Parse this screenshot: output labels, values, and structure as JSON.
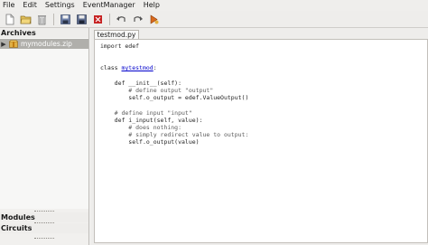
{
  "menu": [
    "File",
    "Edit",
    "Settings",
    "EventManager",
    "Help"
  ],
  "toolbar": {
    "buttons": [
      "new-file",
      "open-file",
      "delete",
      "save",
      "save-as",
      "close",
      "undo",
      "redo",
      "run"
    ]
  },
  "sidebar": {
    "archives_label": "Archives",
    "archive_item": "mymodules.zip",
    "modules_label": "Modules",
    "circuits_label": "Circuits"
  },
  "editor": {
    "tab_label": "testmod.py",
    "lines": [
      {
        "pre": "import edef",
        "cls": "",
        "post": "",
        "type": "code"
      },
      {
        "pre": "class ",
        "cls": "mytestmod",
        "post": ":",
        "type": "code"
      },
      {
        "pre": "    def __init__(self):",
        "cls": "",
        "post": "",
        "type": "code"
      },
      {
        "pre": "        # define output \"output\"",
        "cls": "",
        "post": "",
        "type": "comment"
      },
      {
        "pre": "        self.o_output = edef.ValueOutput()",
        "cls": "",
        "post": "",
        "type": "code"
      },
      {
        "pre": "    # define input \"input\"",
        "cls": "",
        "post": "",
        "type": "comment"
      },
      {
        "pre": "    def i_input(self, value):",
        "cls": "",
        "post": "",
        "type": "code"
      },
      {
        "pre": "        # does nothing:",
        "cls": "",
        "post": "",
        "type": "comment"
      },
      {
        "pre": "        # simply redirect value to output:",
        "cls": "",
        "post": "",
        "type": "comment"
      },
      {
        "pre": "        self.o_output(value)",
        "cls": "",
        "post": "",
        "type": "code"
      }
    ]
  }
}
